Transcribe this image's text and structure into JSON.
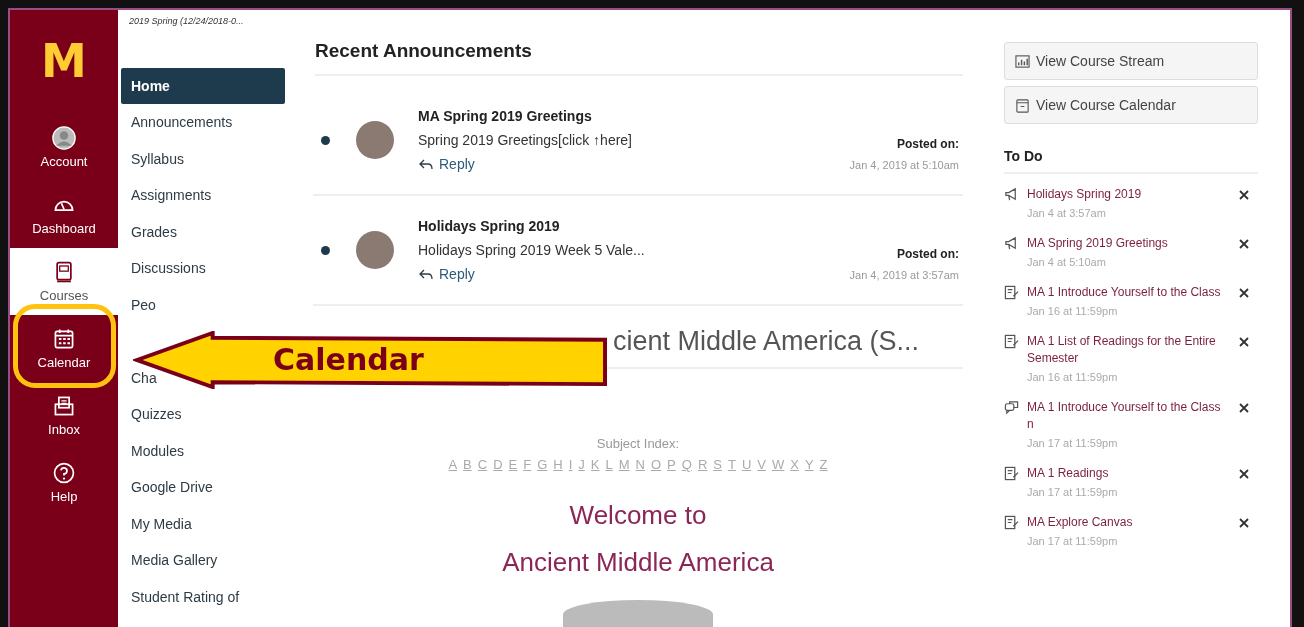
{
  "global_nav": {
    "logo": "M",
    "items": [
      {
        "label": "Account",
        "selected": false
      },
      {
        "label": "Dashboard",
        "selected": false
      },
      {
        "label": "Courses",
        "selected": true
      },
      {
        "label": "Calendar",
        "selected": false
      },
      {
        "label": "Inbox",
        "selected": false
      },
      {
        "label": "Help",
        "selected": false
      }
    ]
  },
  "course_nav": {
    "term": "2019 Spring (12/24/2018-0...",
    "items": [
      {
        "label": "Home",
        "selected": true
      },
      {
        "label": "Announcements",
        "selected": false
      },
      {
        "label": "Syllabus",
        "selected": false
      },
      {
        "label": "Assignments",
        "selected": false
      },
      {
        "label": "Grades",
        "selected": false
      },
      {
        "label": "Discussions",
        "selected": false
      },
      {
        "label": "Peo",
        "selected": false
      },
      {
        "label": "Cha",
        "selected": false
      },
      {
        "label": "Quizzes",
        "selected": false
      },
      {
        "label": "Modules",
        "selected": false
      },
      {
        "label": "Google Drive",
        "selected": false
      },
      {
        "label": "My Media",
        "selected": false
      },
      {
        "label": "Media Gallery",
        "selected": false
      },
      {
        "label": "Student Rating of",
        "selected": false
      }
    ]
  },
  "announcements": {
    "title": "Recent Announcements",
    "items": [
      {
        "title": "MA Spring 2019 Greetings",
        "body": "Spring 2019 Greetings[click ↑here]",
        "reply": "Reply",
        "posted_label": "Posted on:",
        "date": "Jan 4, 2019 at 5:10am",
        "unread": true
      },
      {
        "title": "Holidays Spring 2019",
        "body": "Holidays Spring 2019 Week 5 Vale...",
        "reply": "Reply",
        "posted_label": "Posted on:",
        "date": "Jan 4, 2019 at 3:57am",
        "unread": true
      }
    ]
  },
  "course_heading": "cient Middle America (S...",
  "subject_index": {
    "label": "Subject Index:",
    "letters": [
      "A",
      "B",
      "C",
      "D",
      "E",
      "F",
      "G",
      "H",
      "I",
      "J",
      "K",
      "L",
      "M",
      "N",
      "O",
      "P",
      "Q",
      "R",
      "S",
      "T",
      "U",
      "V",
      "W",
      "X",
      "Y",
      "Z"
    ]
  },
  "welcome": [
    "Welcome to",
    "Ancient Middle America"
  ],
  "callout": {
    "label": "Calendar"
  },
  "sidebar": {
    "buttons": [
      {
        "label": "View Course Stream"
      },
      {
        "label": "View Course Calendar"
      }
    ],
    "todo_title": "To Do",
    "todo": [
      {
        "kind": "announcement",
        "title": "Holidays Spring 2019",
        "date": "Jan 4 at 3:57am"
      },
      {
        "kind": "announcement",
        "title": "MA Spring 2019 Greetings",
        "date": "Jan 4 at 5:10am"
      },
      {
        "kind": "assignment",
        "title": "MA 1 Introduce Yourself to the Class",
        "date": "Jan 16 at 11:59pm"
      },
      {
        "kind": "assignment",
        "title": "MA 1 List of Readings for the Entire Semester",
        "date": "Jan 16 at 11:59pm"
      },
      {
        "kind": "discussion",
        "title": "MA 1 Introduce Yourself to the Class n",
        "date": "Jan 17 at 11:59pm"
      },
      {
        "kind": "assignment",
        "title": "MA 1 Readings",
        "date": "Jan 17 at 11:59pm"
      },
      {
        "kind": "assignment",
        "title": "MA Explore Canvas",
        "date": "Jan 17 at 11:59pm"
      }
    ]
  }
}
